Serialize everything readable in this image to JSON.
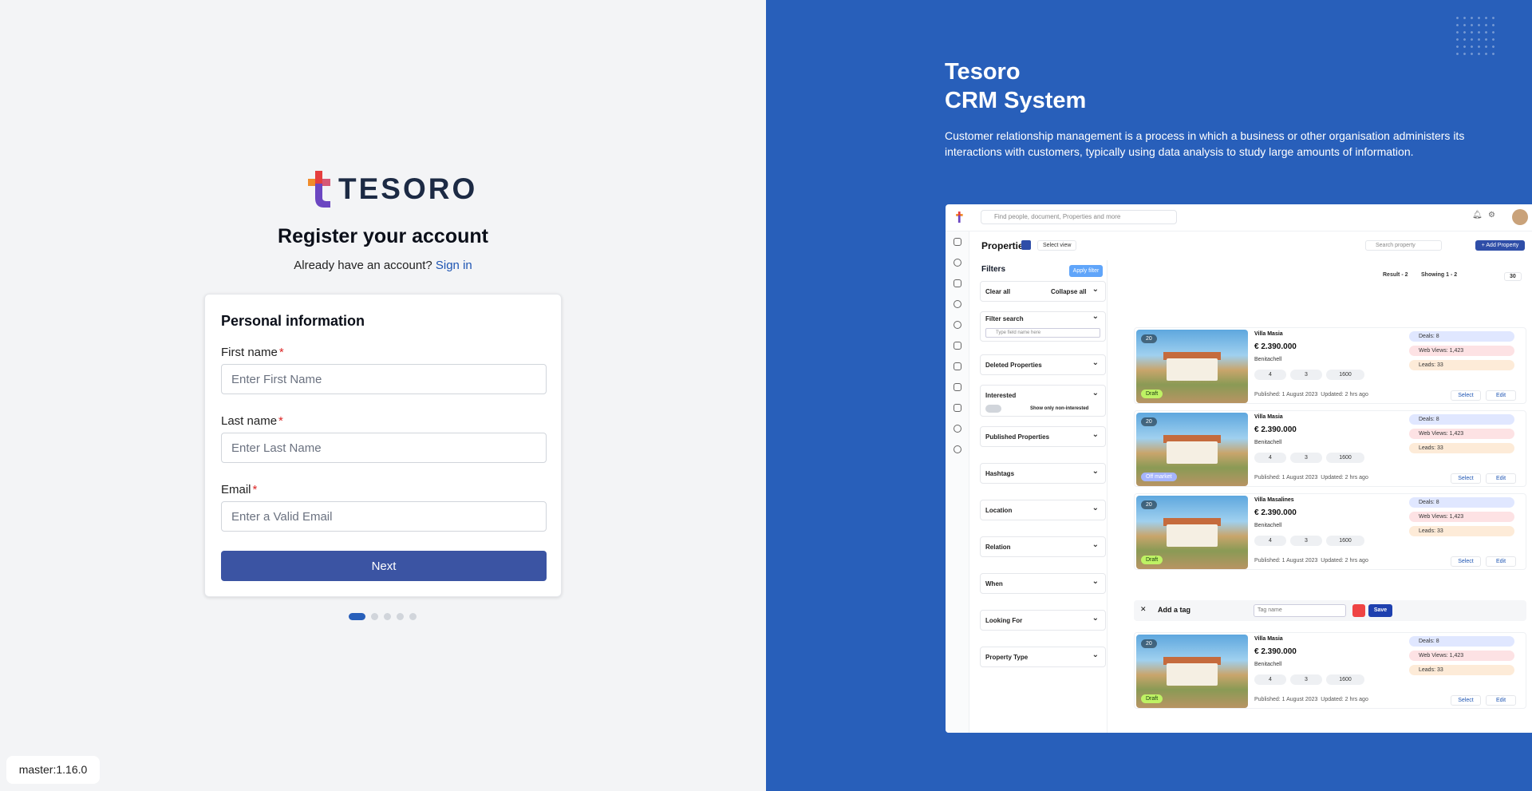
{
  "brand": {
    "name": "TESORO",
    "colors": {
      "accent": "#285fba",
      "button": "#3b54a3",
      "link": "#1e55b3",
      "required": "#dc2626"
    }
  },
  "register": {
    "title": "Register your account",
    "have_account": "Already have an account?",
    "sign_in": "Sign in",
    "section_title": "Personal information",
    "fields": [
      {
        "label": "First name",
        "required_mark": "*",
        "placeholder": "Enter First Name",
        "value": ""
      },
      {
        "label": "Last name",
        "required_mark": "*",
        "placeholder": "Enter Last Name",
        "value": ""
      },
      {
        "label": "Email",
        "required_mark": "*",
        "placeholder": "Enter a Valid Email",
        "value": ""
      }
    ],
    "next_label": "Next",
    "steps_total": 5,
    "step_current": 1
  },
  "version": "master:1.16.0",
  "hero": {
    "title_line1": "Tesoro",
    "title_line2": "CRM System",
    "description": "Customer relationship management is a process in which a business or other organisation administers its interactions with customers, typically using data analysis to study large amounts of information."
  },
  "preview": {
    "search_placeholder": "Find people, document, Properties and more",
    "page_title": "Properties",
    "select_view": "Select view",
    "search_property": "Search property",
    "add_property": "+ Add Property",
    "filters_title": "Filters",
    "apply_filter": "Apply filter",
    "clear_all": "Clear all",
    "collapse_all": "Collapse all",
    "filter_search": "Filter search",
    "filter_search_placeholder": "Type field name here",
    "filters": [
      "Deleted Properties",
      "Interested",
      "Published Properties",
      "Hashtags",
      "Location",
      "Relation",
      "When",
      "Looking For",
      "Property Type"
    ],
    "show_only_non_interested": "Show only non-interested",
    "result": "Result - 2",
    "showing": "Showing 1 - 2",
    "per_page": "30",
    "listings": [
      {
        "name": "Villa Masia",
        "price": "€ 2.390.000",
        "town": "Benitachell",
        "photos": "20",
        "badge": "Draft",
        "beds": "4",
        "baths": "3",
        "area": "1600",
        "published": "Published: 1 August 2023",
        "updated": "Updated: 2 hrs ago",
        "deals": "Deals: 8",
        "views": "Web Views: 1,423",
        "leads": "Leads: 33"
      },
      {
        "name": "Villa Masia",
        "price": "€ 2.390.000",
        "town": "Benitachell",
        "photos": "20",
        "badge": "Off market",
        "beds": "4",
        "baths": "3",
        "area": "1600",
        "published": "Published: 1 August 2023",
        "updated": "Updated: 2 hrs ago",
        "deals": "Deals: 8",
        "views": "Web Views: 1,423",
        "leads": "Leads: 33"
      },
      {
        "name": "Villa Masalines",
        "price": "€ 2.390.000",
        "town": "Benitachell",
        "photos": "20",
        "badge": "Draft",
        "beds": "4",
        "baths": "3",
        "area": "1600",
        "published": "Published: 1 August 2023",
        "updated": "Updated: 2 hrs ago",
        "deals": "Deals: 8",
        "views": "Web Views: 1,423",
        "leads": "Leads: 33"
      },
      {
        "name": "Villa Masia",
        "price": "€ 2.390.000",
        "town": "Benitachell",
        "photos": "20",
        "badge": "Draft",
        "beds": "4",
        "baths": "3",
        "area": "1600",
        "published": "Published: 1 August 2023",
        "updated": "Updated: 2 hrs ago",
        "deals": "Deals: 8",
        "views": "Web Views: 1,423",
        "leads": "Leads: 33"
      }
    ],
    "select_label": "Select",
    "edit_label": "Edit",
    "add_tag": "Add a tag",
    "tag_placeholder": "Tag name",
    "save": "Save"
  }
}
